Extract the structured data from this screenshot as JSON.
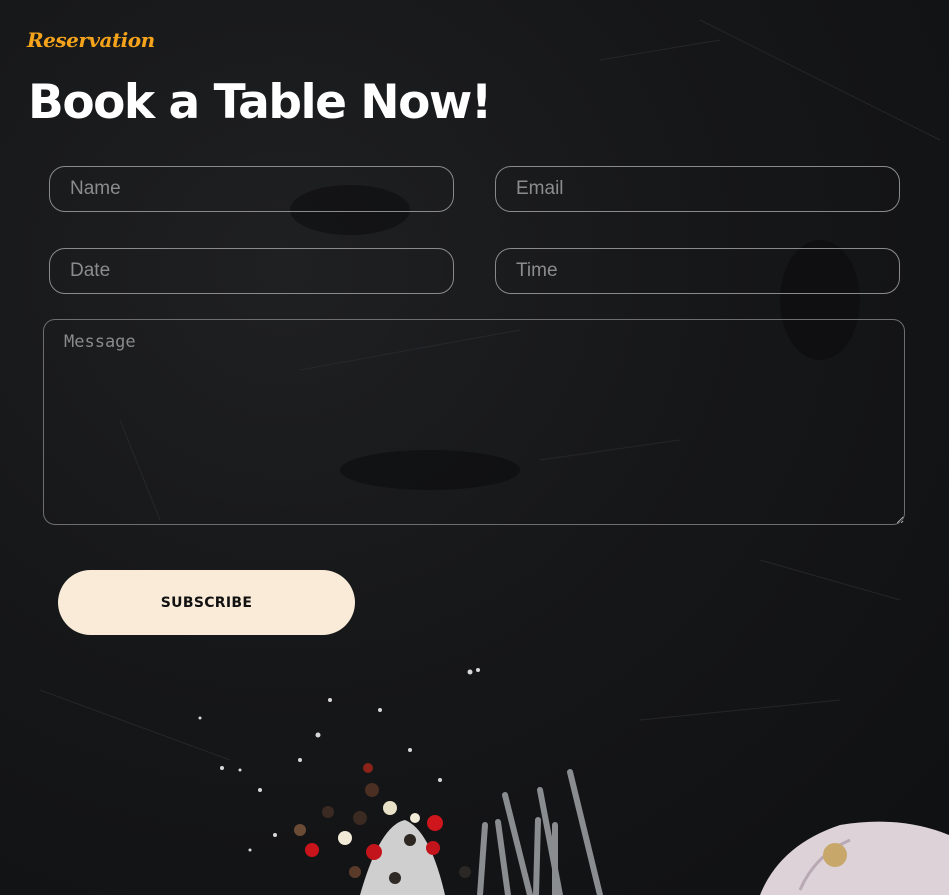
{
  "section": {
    "eyebrow": "Reservation",
    "title": "Book a Table Now!"
  },
  "form": {
    "name_placeholder": "Name",
    "email_placeholder": "Email",
    "date_placeholder": "Date",
    "time_placeholder": "Time",
    "message_placeholder": "Message",
    "submit_label": "SUBSCRIBE"
  },
  "colors": {
    "accent": "#f5a31a",
    "button_bg": "#faebd9",
    "background": "#161719"
  },
  "decor": {
    "background_image": "dark-stone-with-spices-fork-garlic"
  }
}
